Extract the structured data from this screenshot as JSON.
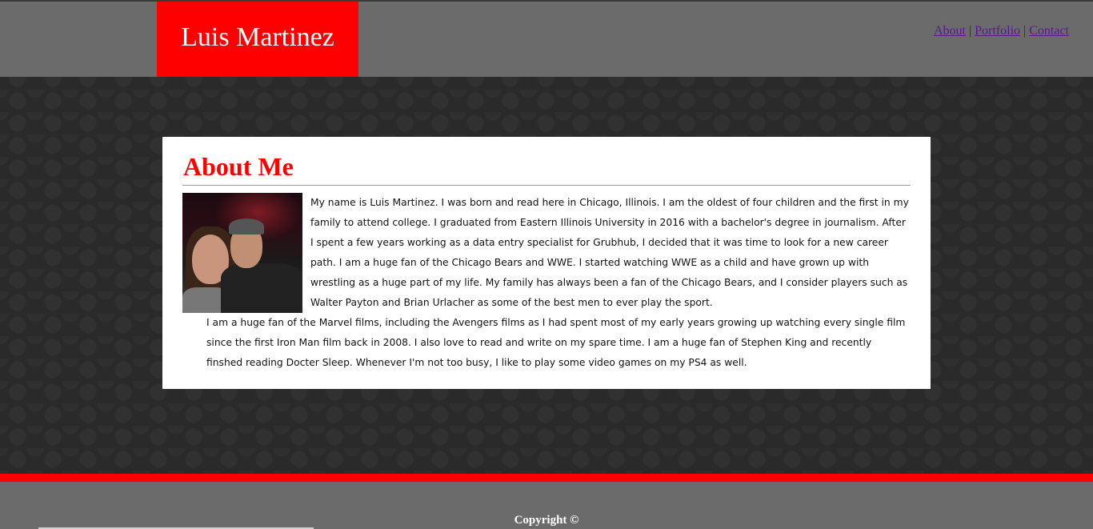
{
  "header": {
    "site_title": "Luis Martinez",
    "nav": {
      "about": "About",
      "portfolio": "Portfolio",
      "contact": "Contact",
      "separator": "|"
    }
  },
  "main": {
    "heading": "About Me",
    "paragraph1": "My name is Luis Martinez. I was born and read here in Chicago, Illinois. I am the oldest of four children and the first in my family to attend college. I graduated from Eastern Illinois University in 2016 with a bachelor's degree in journalism. After I spent a few years working as a data entry specialist for Grubhub, I decided that it was time to look for a new career path. I am a huge fan of the Chicago Bears and WWE. I started watching WWE as a child and have grown up with wrestling as a huge part of my life. My family has always been a fan of the Chicago Bears, and I consider players such as Walter Payton and Brian Urlacher as some of the best men to ever play the sport.",
    "paragraph2": "I am a huge fan of the Marvel films, including the Avengers films as I had spent most of my early years growing up watching every single film since the first Iron Man film back in 2008. I also love to read and write on my spare time. I am a huge fan of Stephen King and recently finshed reading Docter Sleep. Whenever I'm not too busy, I like to play some video games on my PS4 as well."
  },
  "footer": {
    "copyright": "Copyright ©"
  },
  "colors": {
    "accent": "#ff0000",
    "header_bg": "#6b6b6b",
    "page_bg": "#2a2a2a"
  }
}
